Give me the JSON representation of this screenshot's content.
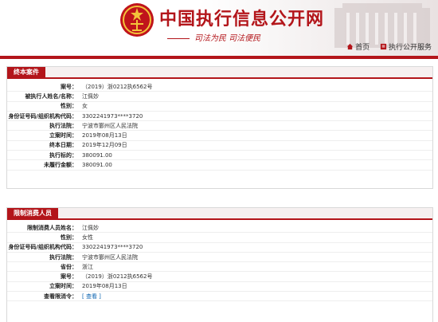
{
  "site": {
    "title": "中国执行信息公开网",
    "slogan": "司法为民  司法便民",
    "links": [
      {
        "label": "首页"
      },
      {
        "label": "执行公开服务"
      }
    ],
    "colors": {
      "brand": "#b3151a"
    }
  },
  "section1": {
    "title": "终本案件",
    "rows": [
      {
        "k": "案号：",
        "v": "（2019）浙0212执6562号"
      },
      {
        "k": "被执行人姓名/名称：",
        "v": "江佩妙"
      },
      {
        "k": "性别：",
        "v": "女"
      },
      {
        "k": "身份证号码/组织机构代码：",
        "v": "3302241973****3720"
      },
      {
        "k": "执行法院：",
        "v": "宁波市鄞州区人民法院"
      },
      {
        "k": "立案时间：",
        "v": "2019年08月13日"
      },
      {
        "k": "终本日期：",
        "v": "2019年12月09日"
      },
      {
        "k": "执行标的：",
        "v": "380091.00"
      },
      {
        "k": "未履行金额：",
        "v": "380091.00"
      }
    ]
  },
  "section2": {
    "title": "限制消费人员",
    "rows": [
      {
        "k": "限制消费人员姓名：",
        "v": "江佩妙"
      },
      {
        "k": "性别：",
        "v": "女性"
      },
      {
        "k": "身份证号码/组织机构代码：",
        "v": "3302241973****3720"
      },
      {
        "k": "执行法院：",
        "v": "宁波市鄞州区人民法院"
      },
      {
        "k": "省份：",
        "v": "浙江"
      },
      {
        "k": "案号：",
        "v": "（2019）浙0212执6562号"
      },
      {
        "k": "立案时间：",
        "v": "2019年08月13日"
      },
      {
        "k": "查看限消令：",
        "v": "[ 查看 ]"
      }
    ]
  }
}
